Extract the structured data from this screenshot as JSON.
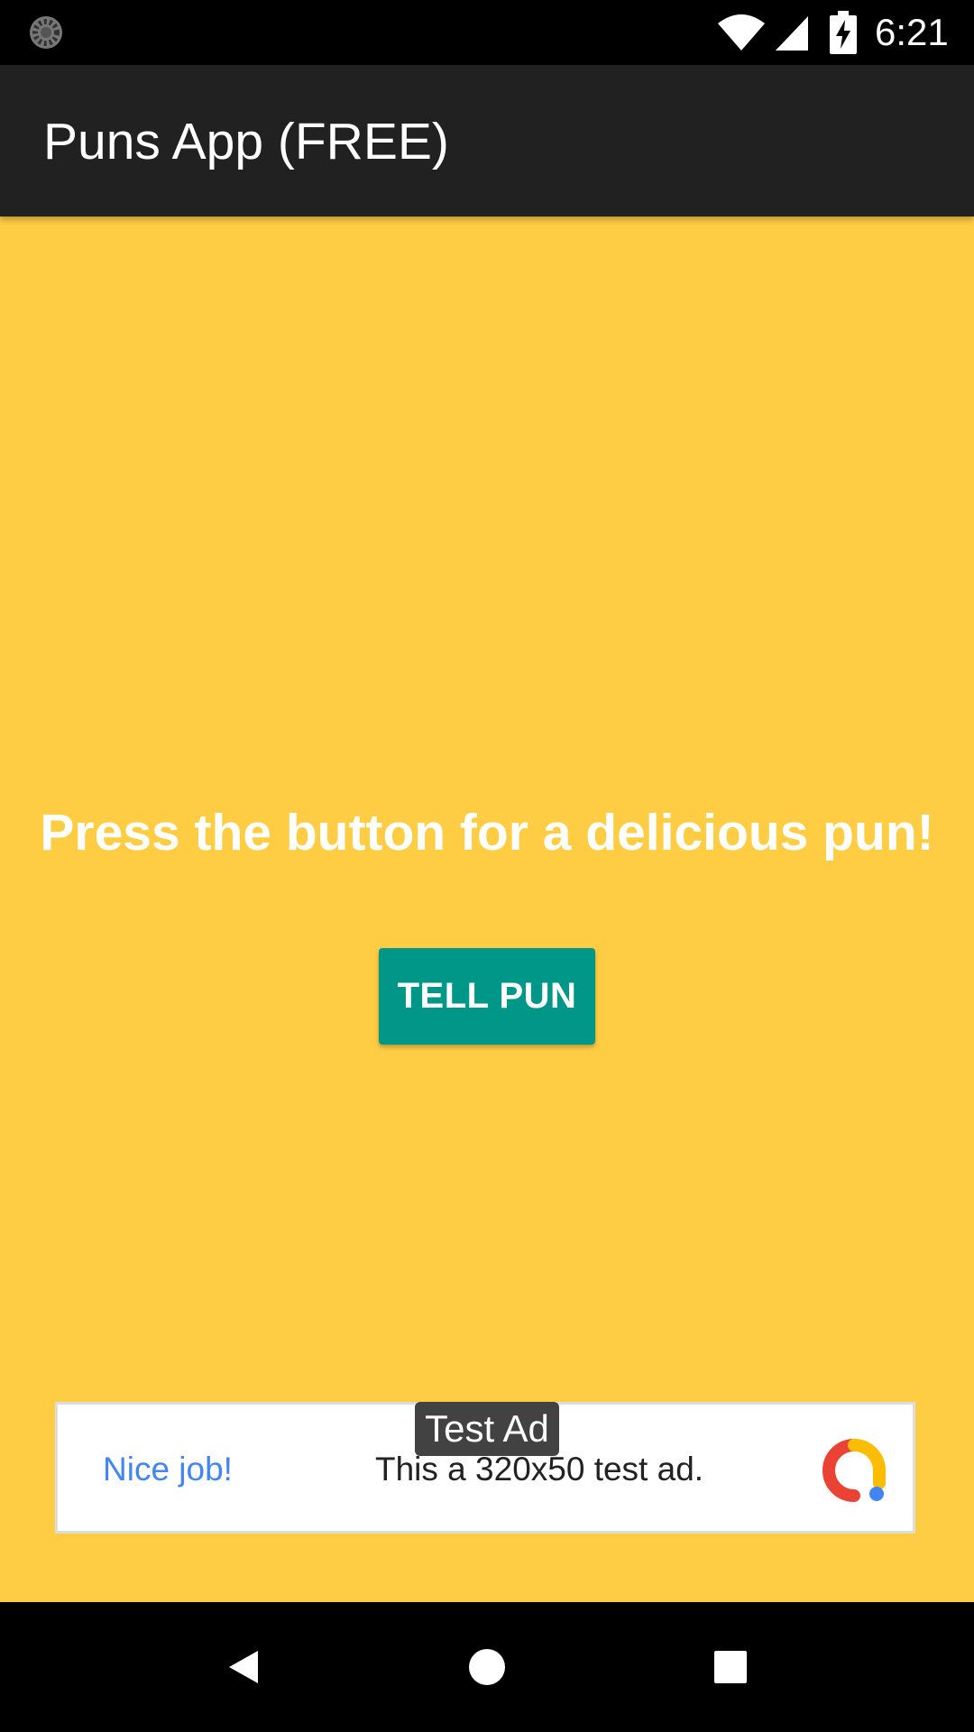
{
  "status_bar": {
    "time": "6:21",
    "icons": [
      "notification-loader-icon",
      "wifi-icon",
      "cell-signal-icon",
      "battery-charging-icon"
    ]
  },
  "app_bar": {
    "title": "Puns App (FREE)",
    "color": "#212121"
  },
  "main": {
    "background_color": "#FFCD44",
    "prompt": "Press the button for a delicious pun!",
    "button_label": "TELL PUN",
    "button_color": "#009688"
  },
  "ad": {
    "label": "Test Ad",
    "headline": "Nice job!",
    "body": "This a 320x50 test ad.",
    "headline_color": "#4285F4",
    "logo_icon": "admob-logo-icon"
  },
  "nav_bar": {
    "icons": [
      "back-icon",
      "home-icon",
      "recents-icon"
    ]
  }
}
